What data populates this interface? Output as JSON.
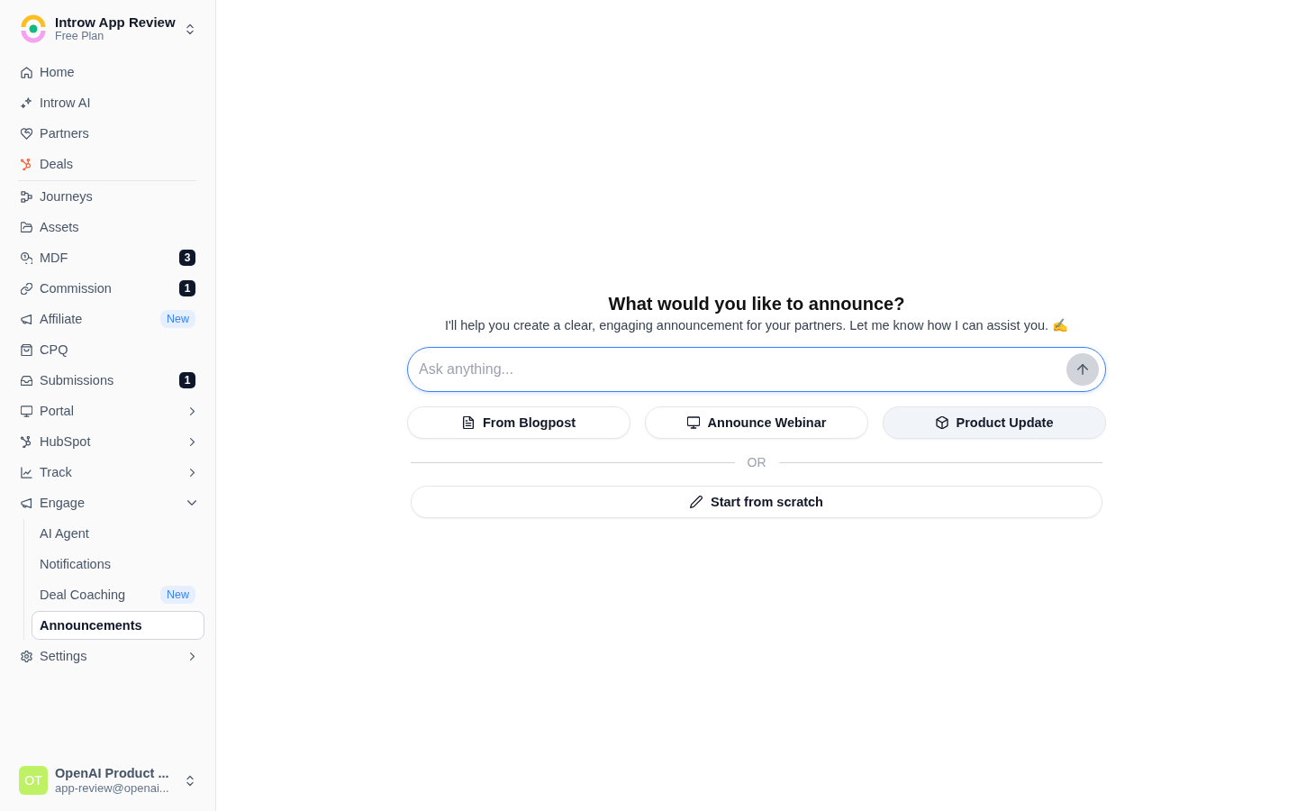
{
  "sidebar": {
    "workspace": {
      "name": "Introw App Review",
      "plan": "Free Plan"
    },
    "sections": [
      {
        "items": [
          {
            "label": "Home",
            "selected": false
          },
          {
            "label": "Introw AI",
            "selected": false
          },
          {
            "label": "Partners",
            "selected": false
          },
          {
            "label": "Deals",
            "selected": false
          }
        ]
      },
      {
        "items": [
          {
            "label": "Journeys",
            "selected": false
          },
          {
            "label": "Assets",
            "selected": false
          },
          {
            "label": "MDF",
            "selected": false,
            "badge": {
              "kind": "count",
              "text": "3"
            }
          },
          {
            "label": "Commission",
            "selected": false,
            "badge": {
              "kind": "count",
              "text": "1"
            }
          },
          {
            "label": "Affiliate",
            "selected": false,
            "badge": {
              "kind": "new",
              "text": "New"
            }
          },
          {
            "label": "CPQ",
            "selected": false
          },
          {
            "label": "Submissions",
            "selected": false,
            "badge": {
              "kind": "count",
              "text": "1"
            }
          },
          {
            "label": "Portal",
            "selected": false,
            "expanded": false
          },
          {
            "label": "HubSpot",
            "selected": false,
            "expanded": false
          },
          {
            "label": "Track",
            "selected": false,
            "expanded": false
          },
          {
            "label": "Engage",
            "selected": false,
            "expanded": true,
            "children": [
              {
                "label": "AI Agent",
                "selected": false
              },
              {
                "label": "Notifications",
                "selected": false
              },
              {
                "label": "Deal Coaching",
                "selected": false,
                "badge": {
                  "kind": "new",
                  "text": "New"
                }
              },
              {
                "label": "Announcements",
                "selected": true
              }
            ]
          },
          {
            "label": "Settings",
            "selected": false,
            "expanded": false
          }
        ]
      }
    ],
    "user": {
      "initials": "OT",
      "name": "OpenAI Product ...",
      "email": "app-review@openai..."
    }
  },
  "composer": {
    "heading": "What would you like to announce?",
    "subtitle": "I'll help you create a clear, engaging announcement for your partners. Let me know how I can assist you. ✍️",
    "input": {
      "placeholder": "Ask anything...",
      "send_disabled": true
    },
    "quick_actions": [
      {
        "label": "From Blogpost",
        "hovered": false
      },
      {
        "label": "Announce Webinar",
        "hovered": false
      },
      {
        "label": "Product Update",
        "hovered": true
      }
    ],
    "separator": "OR",
    "scratch_button": "Start from scratch"
  }
}
